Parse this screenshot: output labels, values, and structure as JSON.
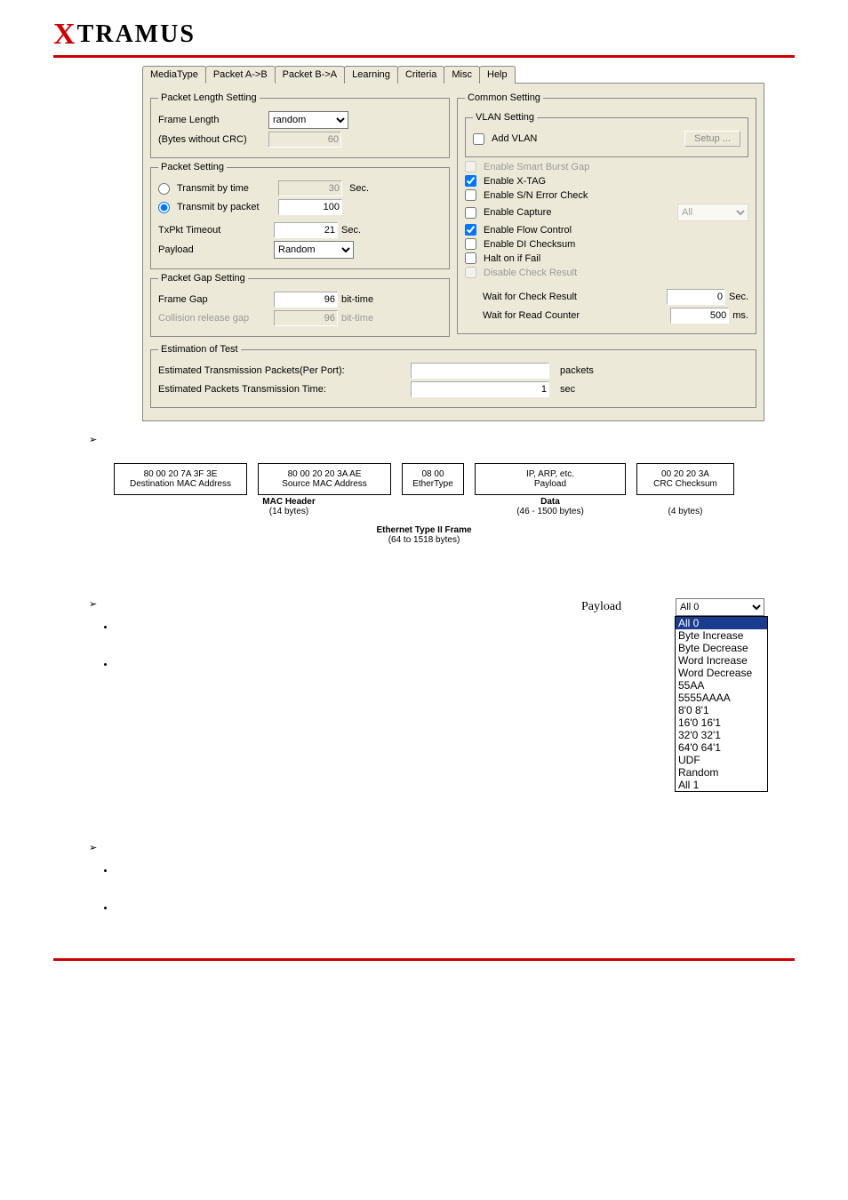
{
  "brand": {
    "name": "XTRAMUS"
  },
  "tabs": [
    "MediaType",
    "Packet A->B",
    "Packet B->A",
    "Learning",
    "Criteria",
    "Misc",
    "Help"
  ],
  "activeTab": 1,
  "left": {
    "pls": {
      "legend": "Packet Length Setting",
      "frameLengthLabel": "Frame Length",
      "frameLengthValue": "random",
      "note": "(Bytes without CRC)",
      "bytesValue": "60"
    },
    "ps": {
      "legend": "Packet Setting",
      "byTime": "Transmit by time",
      "byTimeVal": "30",
      "byTimeUnit": "Sec.",
      "byPacket": "Transmit by packet",
      "byPacketVal": "100",
      "txpktTimeout": "TxPkt Timeout",
      "txpktTimeoutVal": "21",
      "txpktTimeoutUnit": "Sec.",
      "payload": "Payload",
      "payloadVal": "Random"
    },
    "pgs": {
      "legend": "Packet Gap Setting",
      "frameGap": "Frame Gap",
      "frameGapVal": "96",
      "frameGapUnit": "bit-time",
      "collision": "Collision release gap",
      "collisionVal": "96",
      "collisionUnit": "bit-time"
    }
  },
  "right": {
    "cs": {
      "legend": "Common Setting",
      "vlan": {
        "legend": "VLAN Setting",
        "add": "Add VLAN",
        "setup": "Setup ..."
      },
      "opts": {
        "smartGap": "Enable Smart Burst Gap",
        "xtag": "Enable X-TAG",
        "snerr": "Enable S/N Error Check",
        "capture": "Enable Capture",
        "captureSel": "All",
        "flow": "Enable Flow Control",
        "dichk": "Enable DI Checksum",
        "halt": "Halt on if Fail",
        "disableChk": "Disable Check Result"
      },
      "waitCheck": "Wait for Check Result",
      "waitCheckVal": "0",
      "waitCheckUnit": "Sec.",
      "waitRead": "Wait for Read Counter",
      "waitReadVal": "500",
      "waitReadUnit": "ms."
    }
  },
  "est": {
    "legend": "Estimation of Test",
    "l1": "Estimated Transmission Packets(Per Port):",
    "l1val": "",
    "l1unit": "packets",
    "l2": "Estimated Packets Transmission Time:",
    "l2val": "1",
    "l2unit": "sec"
  },
  "frame": {
    "dmac": {
      "hex": "80 00 20 7A 3F 3E",
      "lab": "Destination MAC Address"
    },
    "smac": {
      "hex": "80 00 20 20 3A AE",
      "lab": "Source MAC Address"
    },
    "eth": {
      "hex": "08 00",
      "lab": "EtherType"
    },
    "data": {
      "top": "IP, ARP, etc.",
      "lab": "Payload"
    },
    "crc": {
      "hex": "00 20 20 3A",
      "lab": "CRC Checksum"
    },
    "g1": {
      "name": "MAC Header",
      "sub": "(14 bytes)"
    },
    "g2": {
      "name": "Data",
      "sub": "(46 - 1500 bytes)"
    },
    "g3": {
      "name": "",
      "sub": "(4 bytes)"
    },
    "title": "Ethernet Type II Frame",
    "titlesub": "(64 to 1518 bytes)"
  },
  "payloadDD": {
    "label": "Payload",
    "current": "All 0",
    "options": [
      "All 0",
      "Byte Increase",
      "Byte Decrease",
      "Word Increase",
      "Word Decrease",
      "55AA",
      "5555AAAA",
      "8'0 8'1",
      "16'0 16'1",
      "32'0 32'1",
      "64'0 64'1",
      "UDF",
      "Random",
      "All 1"
    ]
  }
}
